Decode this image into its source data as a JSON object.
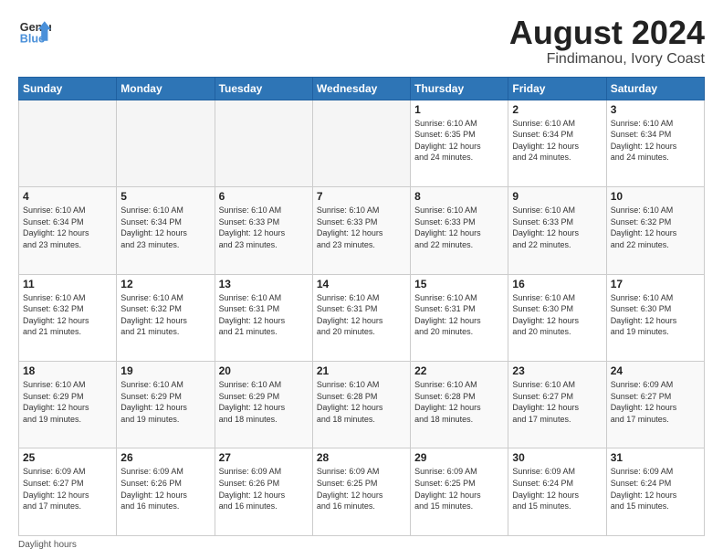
{
  "header": {
    "logo_line1": "General",
    "logo_line2": "Blue",
    "title": "August 2024",
    "subtitle": "Findimanou, Ivory Coast"
  },
  "weekdays": [
    "Sunday",
    "Monday",
    "Tuesday",
    "Wednesday",
    "Thursday",
    "Friday",
    "Saturday"
  ],
  "weeks": [
    [
      {
        "day": "",
        "info": ""
      },
      {
        "day": "",
        "info": ""
      },
      {
        "day": "",
        "info": ""
      },
      {
        "day": "",
        "info": ""
      },
      {
        "day": "1",
        "info": "Sunrise: 6:10 AM\nSunset: 6:35 PM\nDaylight: 12 hours\nand 24 minutes."
      },
      {
        "day": "2",
        "info": "Sunrise: 6:10 AM\nSunset: 6:34 PM\nDaylight: 12 hours\nand 24 minutes."
      },
      {
        "day": "3",
        "info": "Sunrise: 6:10 AM\nSunset: 6:34 PM\nDaylight: 12 hours\nand 24 minutes."
      }
    ],
    [
      {
        "day": "4",
        "info": "Sunrise: 6:10 AM\nSunset: 6:34 PM\nDaylight: 12 hours\nand 23 minutes."
      },
      {
        "day": "5",
        "info": "Sunrise: 6:10 AM\nSunset: 6:34 PM\nDaylight: 12 hours\nand 23 minutes."
      },
      {
        "day": "6",
        "info": "Sunrise: 6:10 AM\nSunset: 6:33 PM\nDaylight: 12 hours\nand 23 minutes."
      },
      {
        "day": "7",
        "info": "Sunrise: 6:10 AM\nSunset: 6:33 PM\nDaylight: 12 hours\nand 23 minutes."
      },
      {
        "day": "8",
        "info": "Sunrise: 6:10 AM\nSunset: 6:33 PM\nDaylight: 12 hours\nand 22 minutes."
      },
      {
        "day": "9",
        "info": "Sunrise: 6:10 AM\nSunset: 6:33 PM\nDaylight: 12 hours\nand 22 minutes."
      },
      {
        "day": "10",
        "info": "Sunrise: 6:10 AM\nSunset: 6:32 PM\nDaylight: 12 hours\nand 22 minutes."
      }
    ],
    [
      {
        "day": "11",
        "info": "Sunrise: 6:10 AM\nSunset: 6:32 PM\nDaylight: 12 hours\nand 21 minutes."
      },
      {
        "day": "12",
        "info": "Sunrise: 6:10 AM\nSunset: 6:32 PM\nDaylight: 12 hours\nand 21 minutes."
      },
      {
        "day": "13",
        "info": "Sunrise: 6:10 AM\nSunset: 6:31 PM\nDaylight: 12 hours\nand 21 minutes."
      },
      {
        "day": "14",
        "info": "Sunrise: 6:10 AM\nSunset: 6:31 PM\nDaylight: 12 hours\nand 20 minutes."
      },
      {
        "day": "15",
        "info": "Sunrise: 6:10 AM\nSunset: 6:31 PM\nDaylight: 12 hours\nand 20 minutes."
      },
      {
        "day": "16",
        "info": "Sunrise: 6:10 AM\nSunset: 6:30 PM\nDaylight: 12 hours\nand 20 minutes."
      },
      {
        "day": "17",
        "info": "Sunrise: 6:10 AM\nSunset: 6:30 PM\nDaylight: 12 hours\nand 19 minutes."
      }
    ],
    [
      {
        "day": "18",
        "info": "Sunrise: 6:10 AM\nSunset: 6:29 PM\nDaylight: 12 hours\nand 19 minutes."
      },
      {
        "day": "19",
        "info": "Sunrise: 6:10 AM\nSunset: 6:29 PM\nDaylight: 12 hours\nand 19 minutes."
      },
      {
        "day": "20",
        "info": "Sunrise: 6:10 AM\nSunset: 6:29 PM\nDaylight: 12 hours\nand 18 minutes."
      },
      {
        "day": "21",
        "info": "Sunrise: 6:10 AM\nSunset: 6:28 PM\nDaylight: 12 hours\nand 18 minutes."
      },
      {
        "day": "22",
        "info": "Sunrise: 6:10 AM\nSunset: 6:28 PM\nDaylight: 12 hours\nand 18 minutes."
      },
      {
        "day": "23",
        "info": "Sunrise: 6:10 AM\nSunset: 6:27 PM\nDaylight: 12 hours\nand 17 minutes."
      },
      {
        "day": "24",
        "info": "Sunrise: 6:09 AM\nSunset: 6:27 PM\nDaylight: 12 hours\nand 17 minutes."
      }
    ],
    [
      {
        "day": "25",
        "info": "Sunrise: 6:09 AM\nSunset: 6:27 PM\nDaylight: 12 hours\nand 17 minutes."
      },
      {
        "day": "26",
        "info": "Sunrise: 6:09 AM\nSunset: 6:26 PM\nDaylight: 12 hours\nand 16 minutes."
      },
      {
        "day": "27",
        "info": "Sunrise: 6:09 AM\nSunset: 6:26 PM\nDaylight: 12 hours\nand 16 minutes."
      },
      {
        "day": "28",
        "info": "Sunrise: 6:09 AM\nSunset: 6:25 PM\nDaylight: 12 hours\nand 16 minutes."
      },
      {
        "day": "29",
        "info": "Sunrise: 6:09 AM\nSunset: 6:25 PM\nDaylight: 12 hours\nand 15 minutes."
      },
      {
        "day": "30",
        "info": "Sunrise: 6:09 AM\nSunset: 6:24 PM\nDaylight: 12 hours\nand 15 minutes."
      },
      {
        "day": "31",
        "info": "Sunrise: 6:09 AM\nSunset: 6:24 PM\nDaylight: 12 hours\nand 15 minutes."
      }
    ]
  ],
  "footer": "Daylight hours"
}
